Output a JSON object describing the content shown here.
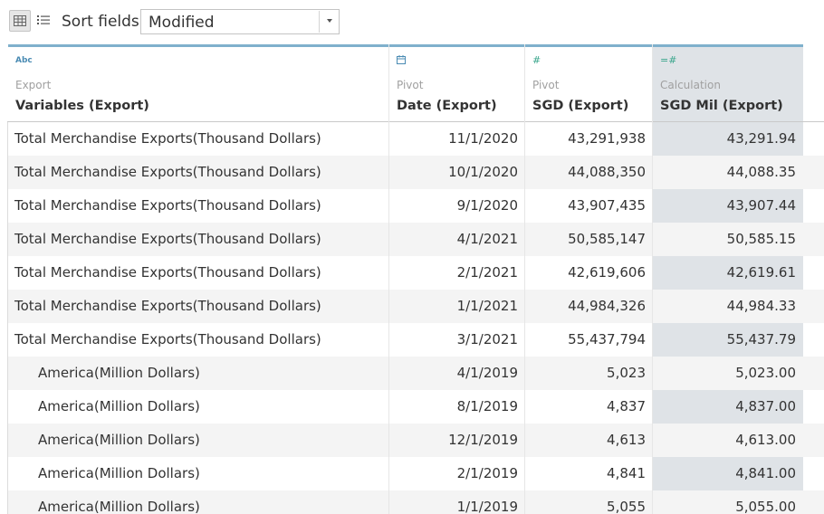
{
  "toolbar": {
    "grid_view_icon": "grid-view-icon",
    "list_view_icon": "list-view-icon",
    "sort_label": "Sort fields",
    "sort_value": "Modified"
  },
  "colors": {
    "accent_bar": "#7fb0cc",
    "calc_column_bg": "#dfe3e7",
    "alt_row_bg": "#f4f4f4"
  },
  "columns": [
    {
      "type_icon": "Abc",
      "source": "Export",
      "name": "Variables (Export)"
    },
    {
      "type_icon": "calendar-icon",
      "source": "Pivot",
      "name": "Date (Export)"
    },
    {
      "type_icon": "#",
      "source": "Pivot",
      "name": "SGD (Export)"
    },
    {
      "type_icon": "=#",
      "source": "Calculation",
      "name": "SGD Mil (Export)"
    }
  ],
  "rows": [
    {
      "variable": "Total Merchandise Exports(Thousand Dollars)",
      "date": "11/1/2020",
      "sgd": "43,291,938",
      "sgd_mil": "43,291.94",
      "indent": false
    },
    {
      "variable": "Total Merchandise Exports(Thousand Dollars)",
      "date": "10/1/2020",
      "sgd": "44,088,350",
      "sgd_mil": "44,088.35",
      "indent": false
    },
    {
      "variable": "Total Merchandise Exports(Thousand Dollars)",
      "date": "9/1/2020",
      "sgd": "43,907,435",
      "sgd_mil": "43,907.44",
      "indent": false
    },
    {
      "variable": "Total Merchandise Exports(Thousand Dollars)",
      "date": "4/1/2021",
      "sgd": "50,585,147",
      "sgd_mil": "50,585.15",
      "indent": false
    },
    {
      "variable": "Total Merchandise Exports(Thousand Dollars)",
      "date": "2/1/2021",
      "sgd": "42,619,606",
      "sgd_mil": "42,619.61",
      "indent": false
    },
    {
      "variable": "Total Merchandise Exports(Thousand Dollars)",
      "date": "1/1/2021",
      "sgd": "44,984,326",
      "sgd_mil": "44,984.33",
      "indent": false
    },
    {
      "variable": "Total Merchandise Exports(Thousand Dollars)",
      "date": "3/1/2021",
      "sgd": "55,437,794",
      "sgd_mil": "55,437.79",
      "indent": false
    },
    {
      "variable": "America(Million Dollars)",
      "date": "4/1/2019",
      "sgd": "5,023",
      "sgd_mil": "5,023.00",
      "indent": true
    },
    {
      "variable": "America(Million Dollars)",
      "date": "8/1/2019",
      "sgd": "4,837",
      "sgd_mil": "4,837.00",
      "indent": true
    },
    {
      "variable": "America(Million Dollars)",
      "date": "12/1/2019",
      "sgd": "4,613",
      "sgd_mil": "4,613.00",
      "indent": true
    },
    {
      "variable": "America(Million Dollars)",
      "date": "2/1/2019",
      "sgd": "4,841",
      "sgd_mil": "4,841.00",
      "indent": true
    },
    {
      "variable": "America(Million Dollars)",
      "date": "1/1/2019",
      "sgd": "5,055",
      "sgd_mil": "5,055.00",
      "indent": true
    }
  ]
}
